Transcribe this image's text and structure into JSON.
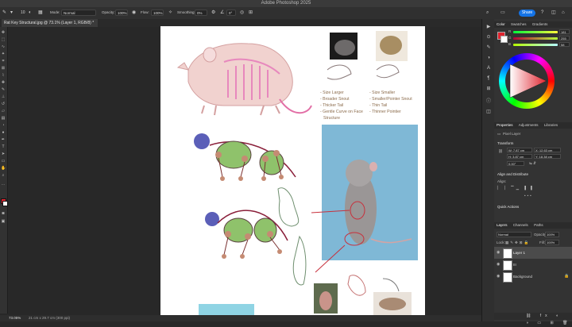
{
  "app": {
    "title": "Adobe Photoshop 2025"
  },
  "options_bar": {
    "mode_label": "Mode:",
    "mode_value": "Normal",
    "opacity_label": "Opacity:",
    "opacity_value": "100%",
    "flow_label": "Flow:",
    "flow_value": "100%",
    "smoothing_label": "Smoothing:",
    "smoothing_value": "0%",
    "angle_value": "0°",
    "brush_size": "10"
  },
  "share_button": "Share",
  "document_tab": {
    "label": "Rat Key Structural.jpg @ 73.1% (Layer 1, RGB/8) *"
  },
  "status": {
    "zoom": "73.05%",
    "size": "21 cm x 29.7 cm (300 ppi)"
  },
  "color_panel": {
    "tabs": [
      "Color",
      "Swatches",
      "Gradients"
    ],
    "active": "Color",
    "sliders": [
      {
        "label": "R",
        "value": "181"
      },
      {
        "label": "G",
        "value": "255"
      },
      {
        "label": "B",
        "value": "58"
      }
    ]
  },
  "properties_panel": {
    "tabs": [
      "Properties",
      "Adjustments",
      "Libraries"
    ],
    "active": "Properties",
    "layer_type": "Pixel Layer",
    "transform_title": "Transform",
    "w": "W: 7.87 cm",
    "h": "H: 3.87 cm",
    "x": "X: 12.63 cm",
    "y": "Y: 18.38 cm",
    "angle": "0.00°",
    "align_title": "Align and Distribute",
    "align_label": "Align:",
    "quick_actions_title": "Quick Actions"
  },
  "layers_panel": {
    "tabs": [
      "Layers",
      "Channels",
      "Paths"
    ],
    "active": "Layers",
    "blend_mode": "Normal",
    "opacity_label": "Opacity:",
    "opacity_value": "100%",
    "lock_label": "Lock:",
    "fill_label": "Fill:",
    "fill_value": "100%",
    "layers": [
      {
        "name": "Layer 1",
        "selected": true
      },
      {
        "name": "III",
        "selected": false
      },
      {
        "name": "Background",
        "selected": false
      }
    ]
  },
  "canvas": {
    "left_column_notes": [
      "Size Larger",
      "Broader Snout",
      "Thicker Tail",
      "Gentle Curve on Face",
      "Structure"
    ],
    "right_column_notes": [
      "Size Smaller",
      "Smaller/Pointer Snout",
      "Thin Tail",
      "Thinner Pointier"
    ]
  },
  "colors": {
    "accent": "#1473e6",
    "foreground": "#e0242f",
    "background": "#ffffff"
  }
}
